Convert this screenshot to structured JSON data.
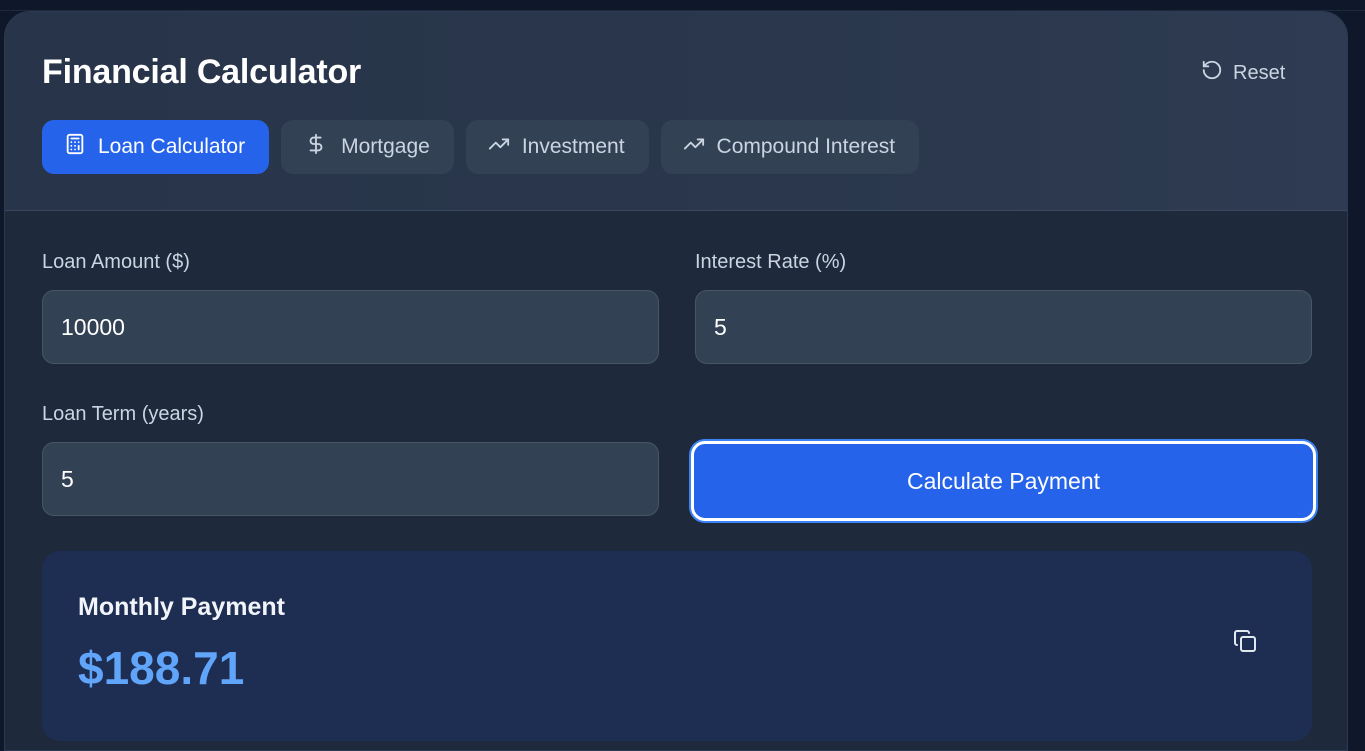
{
  "header": {
    "title": "Financial Calculator",
    "reset_label": "Reset"
  },
  "tabs": [
    {
      "label": "Loan Calculator",
      "icon": "calculator-icon",
      "active": true
    },
    {
      "label": "Mortgage",
      "icon": "dollar-icon",
      "active": false
    },
    {
      "label": "Investment",
      "icon": "trending-up-icon",
      "active": false
    },
    {
      "label": "Compound Interest",
      "icon": "trending-up-icon",
      "active": false
    }
  ],
  "form": {
    "loan_amount": {
      "label": "Loan Amount ($)",
      "value": "10000"
    },
    "interest_rate": {
      "label": "Interest Rate (%)",
      "value": "5"
    },
    "loan_term": {
      "label": "Loan Term (years)",
      "value": "5"
    },
    "calculate_label": "Calculate Payment"
  },
  "result": {
    "label": "Monthly Payment",
    "value": "$188.71",
    "copy_icon": "copy-icon"
  },
  "colors": {
    "accent": "#2563eb",
    "result_value": "#60a5fa",
    "card_bg": "#1e293b",
    "result_bg": "#1e2d52"
  }
}
